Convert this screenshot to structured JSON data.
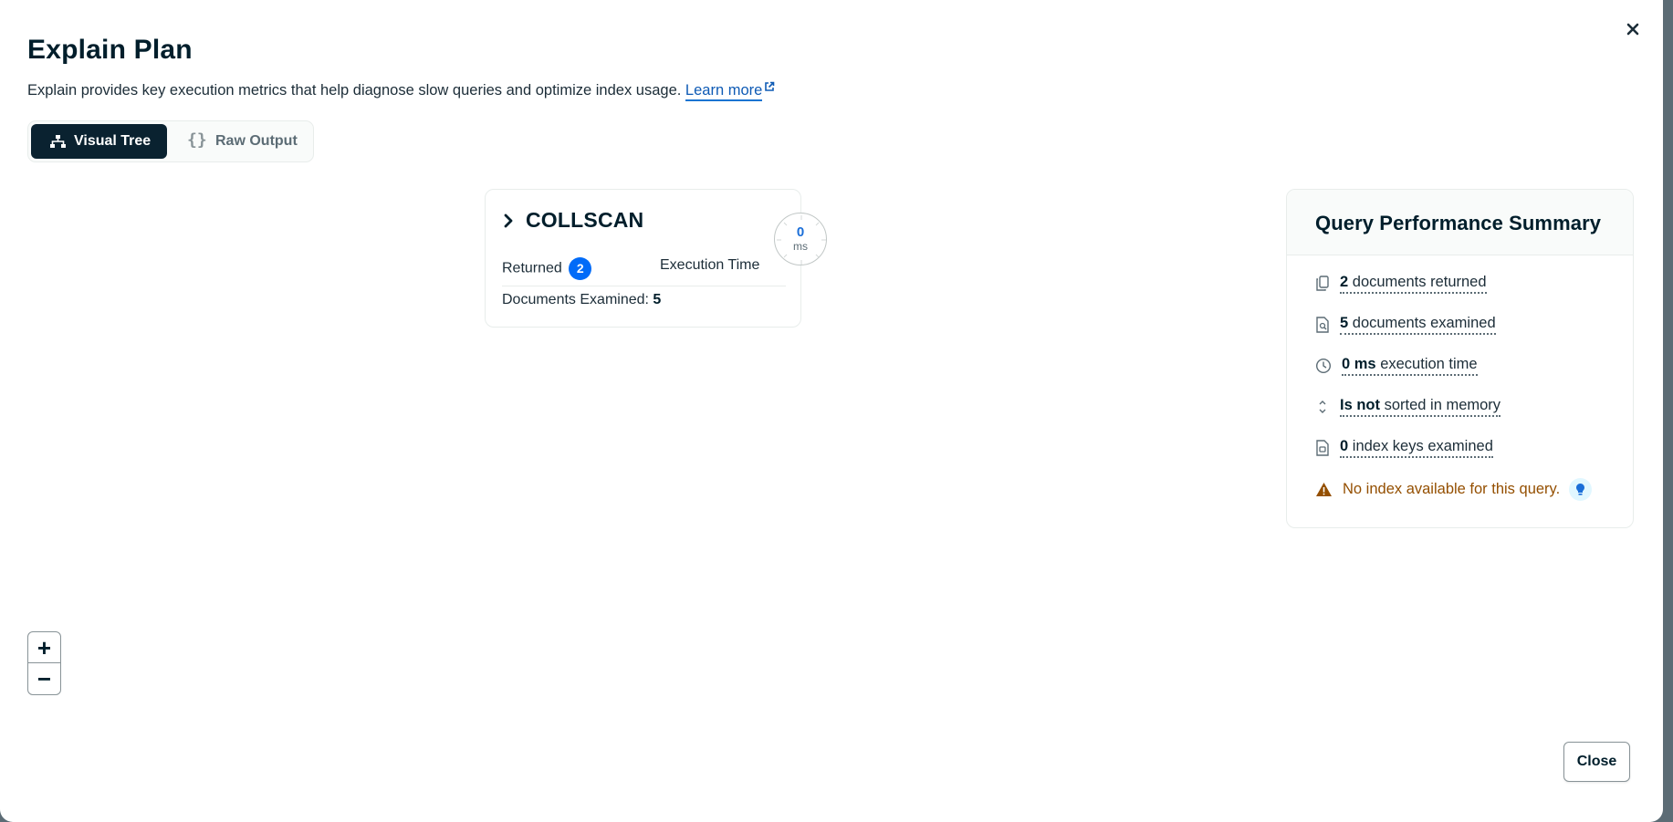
{
  "modal": {
    "title": "Explain Plan",
    "subtitle": "Explain provides key execution metrics that help diagnose slow queries and optimize index usage.",
    "learn_more": "Learn more"
  },
  "view_toggle": {
    "visual_tree": "Visual Tree",
    "raw_output": "Raw Output",
    "raw_output_icon_text": "{}"
  },
  "stage": {
    "name": "COLLSCAN",
    "returned_label": "Returned",
    "returned_count": "2",
    "execution_time_label": "Execution Time",
    "execution_time_value": "0",
    "execution_time_unit": "ms",
    "examined_label": "Documents Examined:",
    "examined_value": "5"
  },
  "summary": {
    "title": "Query Performance Summary",
    "returned_value": "2",
    "returned_label": "documents returned",
    "examined_value": "5",
    "examined_label": "documents examined",
    "exec_value": "0 ms",
    "exec_label": "execution time",
    "sorted_value": "Is not",
    "sorted_label": "sorted in memory",
    "keys_value": "0",
    "keys_label": "index keys examined",
    "warning": "No index available for this query."
  },
  "zoom": {
    "in": "+",
    "out": "−"
  },
  "footer": {
    "close_label": "Close"
  },
  "colors": {
    "primary": "#016bf8",
    "dark": "#001e2b",
    "warning": "#944f01",
    "toggle_active": "#0a2230"
  }
}
